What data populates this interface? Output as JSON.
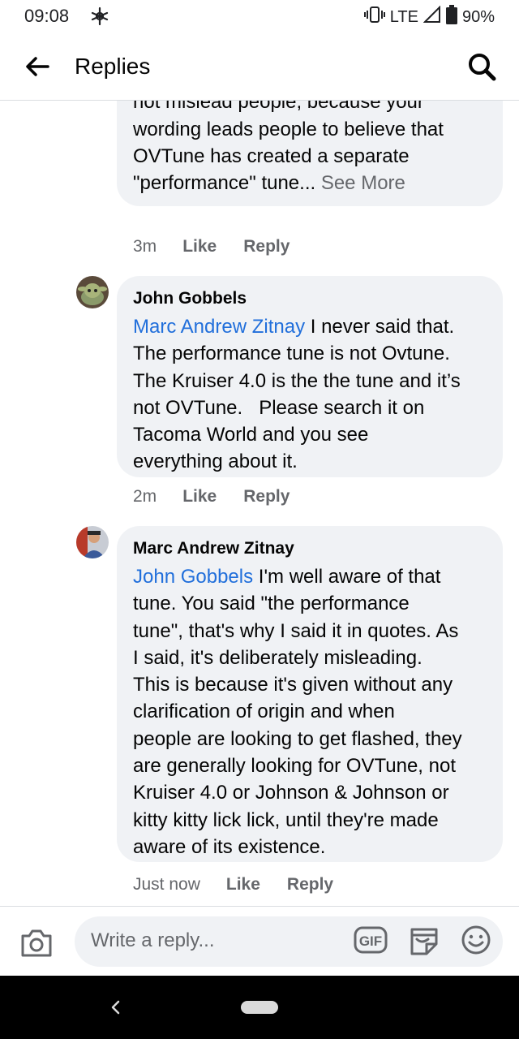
{
  "status_bar": {
    "time": "09:08",
    "network": "LTE",
    "battery": "90%"
  },
  "header": {
    "title": "Replies",
    "back_icon": "arrow-left-icon",
    "search_icon": "search-icon"
  },
  "comments": [
    {
      "partial_text": "private party creation/offer. Please do\nnot mislead people, because your\nwording leads people to believe that\nOVTune has created a separate\n\"performance\" tune...",
      "see_more": "See More",
      "time": "3m",
      "like": "Like",
      "reply": "Reply"
    },
    {
      "author": "John Gobbels",
      "mention": "Marc Andrew Zitnay",
      "text": " I never said that.\nThe performance tune is not Ovtune.\nThe Kruiser 4.0 is the the tune and it’s\nnot OVTune.   Please search it on\nTacoma World and you see\neverything about it.",
      "time": "2m",
      "like": "Like",
      "reply": "Reply"
    },
    {
      "author": "Marc Andrew Zitnay",
      "mention": "John Gobbels",
      "text": " I'm well aware of that\ntune. You said \"the performance\ntune\", that's why I said it in quotes. As\nI said, it's deliberately misleading.\nThis is because it's given without any\nclarification of origin and when\npeople are looking to get flashed, they\nare generally looking for OVTune, not\nKruiser 4.0 or Johnson & Johnson or\nkitty kitty lick lick, until they're made\naware of its existence.",
      "time": "Just now",
      "like": "Like",
      "reply": "Reply"
    }
  ],
  "composer": {
    "placeholder": "Write a reply...",
    "gif_label": "GIF"
  },
  "colors": {
    "mention": "#216fdb",
    "bubble": "#f0f2f5",
    "secondary_text": "#65676b"
  }
}
